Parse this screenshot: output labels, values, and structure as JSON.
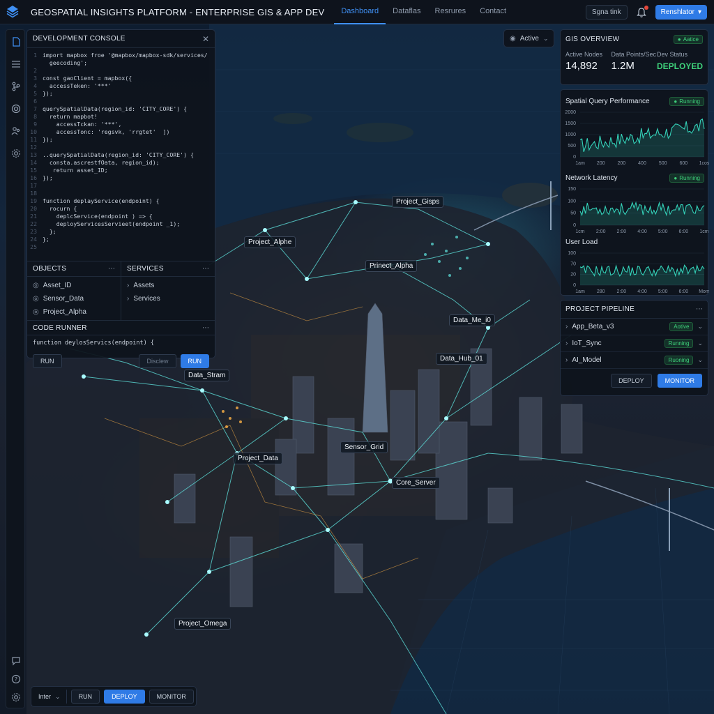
{
  "header": {
    "title": "GEOSPATIAL INSIGHTS PLATFORM - ENTERPRISE GIS & APP DEV",
    "nav": [
      {
        "label": "Dashboard",
        "active": true
      },
      {
        "label": "Dataflas",
        "active": false
      },
      {
        "label": "Resrures",
        "active": false
      },
      {
        "label": "Contact",
        "active": false
      }
    ],
    "signal_button": "Sgna tink",
    "user_button": "Renshlator",
    "accent": "#2f7be6"
  },
  "rail": {
    "icons": [
      "document-icon",
      "list-icon",
      "branch-icon",
      "target-icon",
      "users-icon",
      "settings-icon",
      "chat-icon",
      "help-icon",
      "gear-icon"
    ]
  },
  "console": {
    "title": "DEVELOPMENT CONSOLE",
    "code": [
      {
        "n": "1",
        "t": "import mapbox froe '@mapbox/mapbox-sdk/services/"
      },
      {
        "n": "",
        "t": "  geecoding';"
      },
      {
        "n": "2",
        "t": ""
      },
      {
        "n": "3",
        "t": "const gaoClient = mapbox({"
      },
      {
        "n": "4",
        "t": "  accessTeken: '***'"
      },
      {
        "n": "5",
        "t": "});"
      },
      {
        "n": "6",
        "t": ""
      },
      {
        "n": "7",
        "t": "querySpatialData(region_id: 'CITY_CORE') {"
      },
      {
        "n": "8",
        "t": "  return mapbot!"
      },
      {
        "n": "9",
        "t": "    accessTckan: '***',"
      },
      {
        "n": "10",
        "t": "    accessTonc: 'regsvk, 'rrgtet'  ])"
      },
      {
        "n": "11",
        "t": "});"
      },
      {
        "n": "12",
        "t": ""
      },
      {
        "n": "13",
        "t": "..querySpatialData(region_id: 'CITY_CORE') {"
      },
      {
        "n": "14",
        "t": "  consta.ascrestfOata, region_id);"
      },
      {
        "n": "15",
        "t": "   return asset_ID;"
      },
      {
        "n": "16",
        "t": "});"
      },
      {
        "n": "17",
        "t": ""
      },
      {
        "n": "18",
        "t": ""
      },
      {
        "n": "19",
        "t": "function deplayService(endpoint) {"
      },
      {
        "n": "20",
        "t": "  rocurn {"
      },
      {
        "n": "21",
        "t": "    deplcService(endpoint ) => {"
      },
      {
        "n": "22",
        "t": "    deployServicesServieet(endpoint _1);"
      },
      {
        "n": "23",
        "t": "  };"
      },
      {
        "n": "24",
        "t": "};"
      },
      {
        "n": "25",
        "t": ""
      }
    ],
    "objects": {
      "title": "OBJECTS",
      "items": [
        "Asset_ID",
        "Sensor_Data",
        "Project_Alpha"
      ]
    },
    "services": {
      "title": "SERVICES",
      "items": [
        "Assets",
        "Services"
      ]
    },
    "runner": {
      "title": "CODE RUNNER",
      "code": "function deylosServics(endpoint) {",
      "run_small": "RUN",
      "disclose": "Disclew",
      "run": "RUN"
    }
  },
  "active_dropdown": "Active",
  "gis_overview": {
    "title": "GIS OVERVIEW",
    "badge": "Aatice",
    "stats": [
      {
        "label": "Active Nodes",
        "value": "14,892"
      },
      {
        "label": "Data Points/Sec",
        "value": "1.2M"
      },
      {
        "label": "Dev Status",
        "value": "DEPLOYED"
      }
    ]
  },
  "performance": [
    {
      "title": "Spatial Query Performance",
      "badge": "Running",
      "yticks": [
        "2000",
        "1500",
        "1000",
        "500",
        "0"
      ],
      "xticks": [
        "1am",
        "200",
        "200",
        "400",
        "500",
        "600",
        "1cos"
      ]
    },
    {
      "title": "Network Latency",
      "badge": "Running",
      "yticks": [
        "150",
        "100",
        "50",
        "0"
      ],
      "xticks": [
        "1cm",
        "2:00",
        "2:00",
        "4:00",
        "5:00",
        "6:00",
        "1cm"
      ]
    },
    {
      "title": "User Load",
      "badge": "",
      "yticks": [
        "100",
        "70",
        "20",
        "0"
      ],
      "xticks": [
        "1am",
        "280",
        "2:00",
        "4:00",
        "5:00",
        "6:00",
        "Mom"
      ]
    }
  ],
  "pipeline": {
    "title": "PROJECT PIPELINE",
    "items": [
      {
        "name": "App_Beta_v3",
        "status": "Aotive"
      },
      {
        "name": "IoT_Sync",
        "status": "Running"
      },
      {
        "name": "AI_Model",
        "status": "Ruoning"
      }
    ],
    "deploy": "DEPLOY",
    "monitor": "MONITOR"
  },
  "bottom_bar": {
    "font": "Inter",
    "run": "RUN",
    "deploy": "DEPLOY",
    "monitor": "MONITOR"
  },
  "map_labels": [
    "Project_Gisps",
    "Project_Alphe",
    "Prinect_Alpha",
    "Data_Me_i0",
    "Data_Hub_01",
    "Data_Stram",
    "Sensor_Grid",
    "Project_Data",
    "Core_Server",
    "Project_Omega"
  ],
  "colors": {
    "running": "#3ed07a",
    "chart_line": "#34d1b8",
    "map_network": "#5fe6e0"
  }
}
